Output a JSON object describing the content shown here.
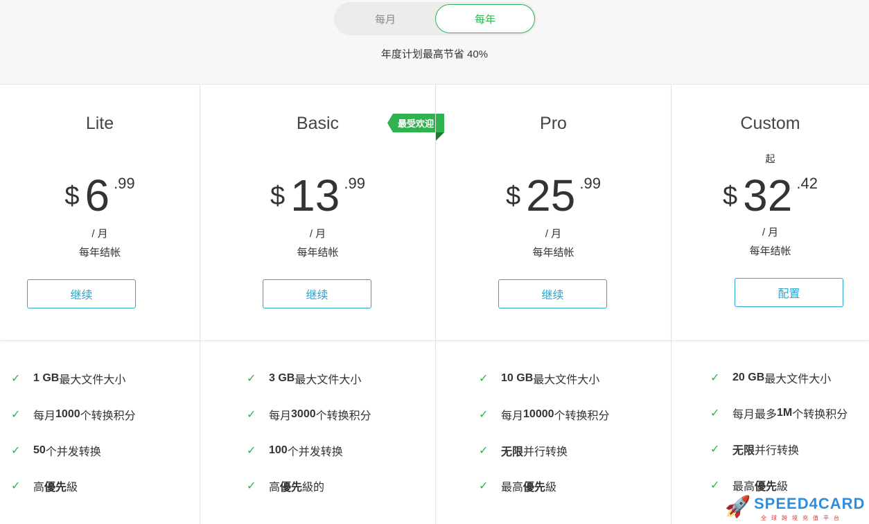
{
  "billing_toggle": {
    "monthly": "每月",
    "yearly": "每年",
    "selected": "yearly"
  },
  "savings_note": "年度计划最高节省 40%",
  "popular_badge": "最受欢迎",
  "plans": [
    {
      "name": "Lite",
      "from": "",
      "currency": "$",
      "amount": "6",
      "cents": ".99",
      "per": "/ 月",
      "billed": "每年结帐",
      "button": "继续",
      "features": [
        {
          "strong": "1 GB",
          "text": " 最大文件大小"
        },
        {
          "pre": "每月 ",
          "strong": "1000",
          "text": " 个转换积分"
        },
        {
          "strong": "50",
          "text": " 个并发转换"
        },
        {
          "pre": "高",
          "strong": "優先",
          "text": "級"
        }
      ]
    },
    {
      "name": "Basic",
      "from": "",
      "currency": "$",
      "amount": "13",
      "cents": ".99",
      "per": "/ 月",
      "billed": "每年结帐",
      "button": "继续",
      "features": [
        {
          "strong": "3 GB",
          "text": " 最大文件大小"
        },
        {
          "pre": "每月 ",
          "strong": "3000",
          "text": " 个转换积分"
        },
        {
          "strong": "100",
          "text": " 个并发转换"
        },
        {
          "pre": "高",
          "strong": "優先",
          "text": "級的"
        }
      ]
    },
    {
      "name": "Pro",
      "from": "",
      "currency": "$",
      "amount": "25",
      "cents": ".99",
      "per": "/ 月",
      "billed": "每年结帐",
      "button": "继续",
      "features": [
        {
          "strong": "10 GB",
          "text": " 最大文件大小"
        },
        {
          "pre": "每月 ",
          "strong": "10000",
          "text": " 个转换积分"
        },
        {
          "strong": "无限",
          "text": "并行转换"
        },
        {
          "pre": "最高",
          "strong": "優先",
          "text": "級"
        }
      ]
    },
    {
      "name": "Custom",
      "from": "起",
      "currency": "$",
      "amount": "32",
      "cents": ".42",
      "per": "/ 月",
      "billed": "每年结帐",
      "button": "配置",
      "features": [
        {
          "strong": "20 GB",
          "text": " 最大文件大小"
        },
        {
          "pre": "每月最多 ",
          "strong": "1M",
          "text": " 个转换积分"
        },
        {
          "strong": "无限",
          "text": "并行转换"
        },
        {
          "pre": "最高",
          "strong": "優先",
          "text": "級"
        }
      ]
    }
  ],
  "watermark": {
    "name": "SPEED4CARD",
    "sub": "全球跨境充值平台"
  },
  "colors": {
    "accent_green": "#2fb34f",
    "button_blue": "#2aa3c9"
  }
}
